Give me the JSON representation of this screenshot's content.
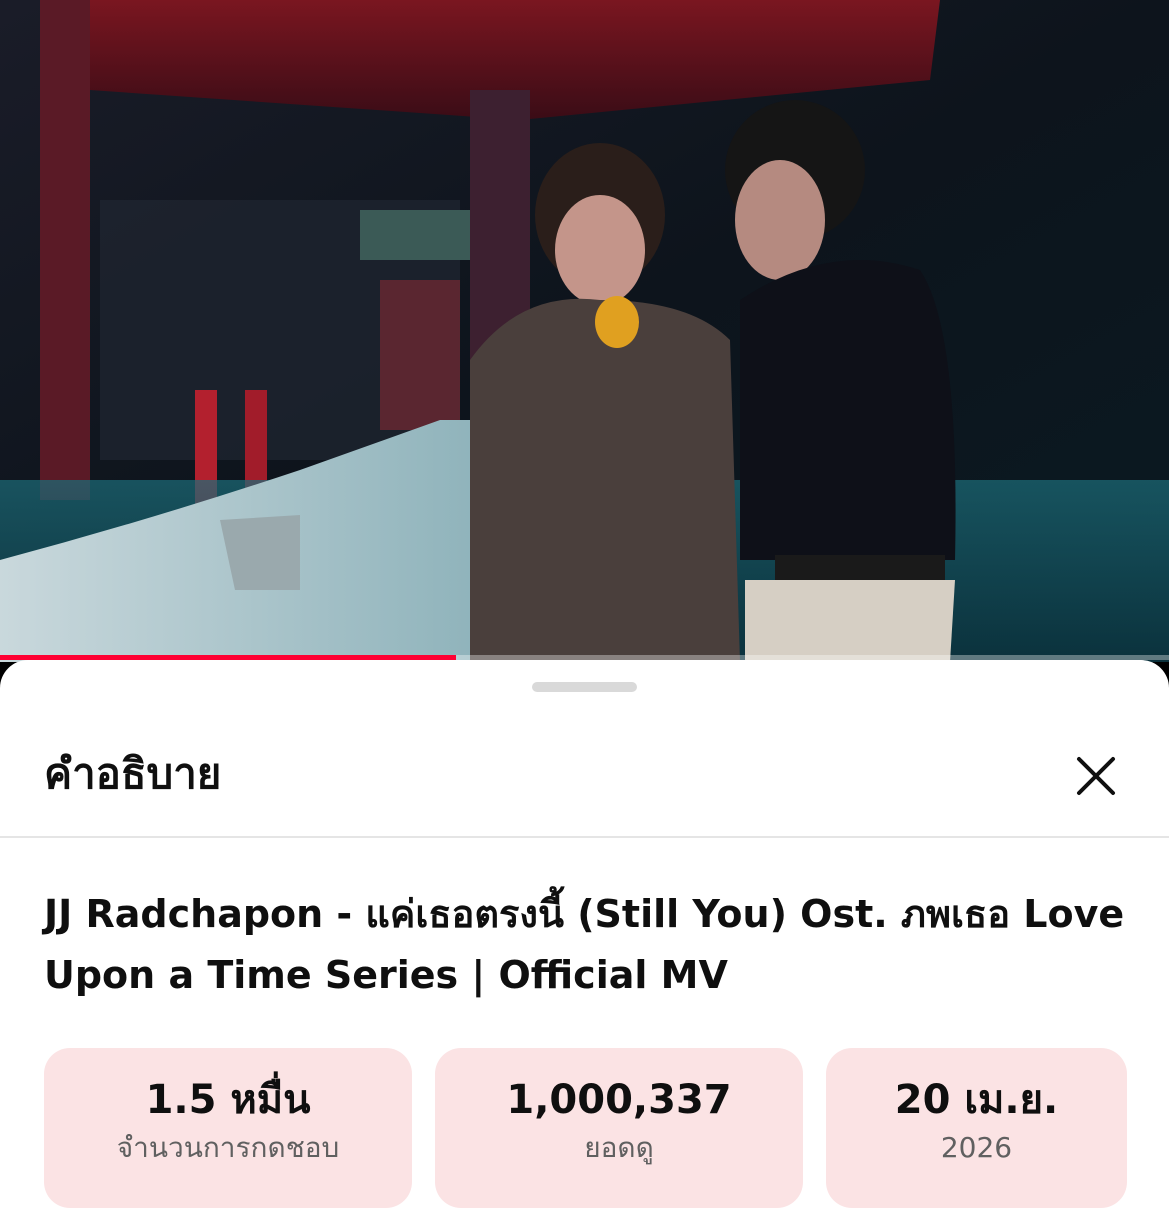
{
  "player": {
    "progress_fraction": 0.39,
    "accent_color": "#ff0033"
  },
  "description_panel": {
    "heading": "คำอธิบาย",
    "close_icon": "close-icon",
    "video_title": "JJ Radchapon - แค่เธอตรงนี้ (Still You) Ost. ภพเธอ Love Upon a Time Series | Official MV",
    "stats": [
      {
        "value": "1.5 หมื่น",
        "label": "จำนวนการกดชอบ"
      },
      {
        "value": "1,000,337",
        "label": "ยอดดู"
      },
      {
        "value": "20 เม.ย.",
        "label": "2026"
      }
    ],
    "card_color": "#fbe3e4"
  }
}
